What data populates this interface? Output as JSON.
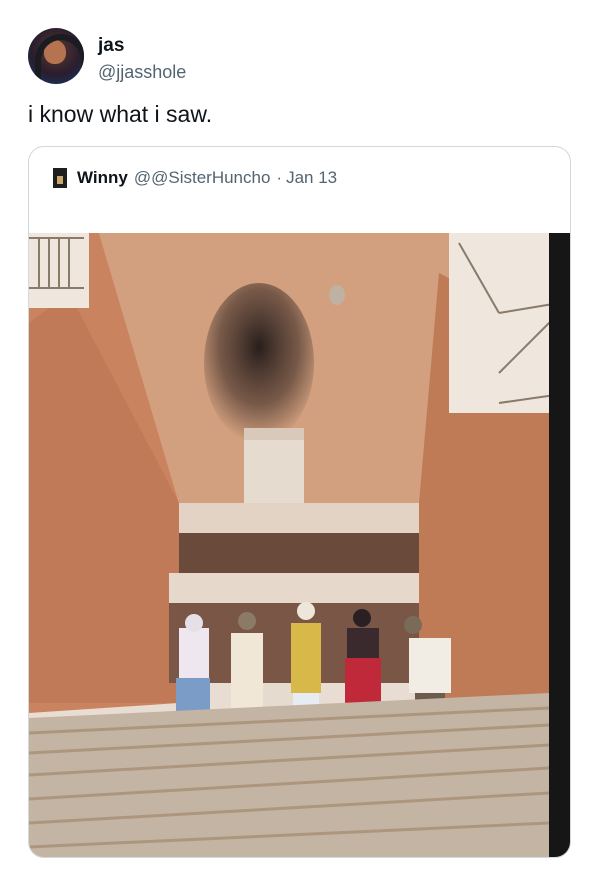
{
  "author": {
    "display_name": "jas",
    "handle": "@jjasshole",
    "avatar_icon": "profile-avatar"
  },
  "tweet_text": "i know what i saw.",
  "quoted_tweet": {
    "display_name": "Winny",
    "handle": "@@SisterHuncho",
    "separator": "·",
    "date": "Jan 13",
    "avatar_icon": "profile-avatar"
  },
  "photo": {
    "colors": {
      "wall": "#c98b66",
      "wall_dark": "#b97452",
      "ceiling": "#d6a786",
      "pillar": "#e8dcd0",
      "soot": "#2a2220",
      "steps": "#c9b9a6"
    }
  }
}
